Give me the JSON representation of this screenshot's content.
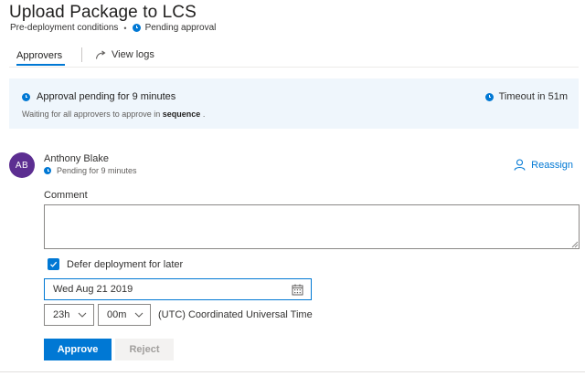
{
  "header": {
    "title": "Upload Package to LCS",
    "condition": "Pre-deployment conditions",
    "separator": "•",
    "status": "Pending approval"
  },
  "tabs": {
    "approvers": "Approvers",
    "view_logs": "View logs"
  },
  "banner": {
    "title": "Approval pending for 9 minutes",
    "subtitle_prefix": "Waiting for all approvers to approve in",
    "subtitle_emphasis": "sequence",
    "subtitle_suffix": ".",
    "timeout": "Timeout in 51m"
  },
  "approver": {
    "initials": "AB",
    "name": "Anthony Blake",
    "status": "Pending for 9 minutes",
    "reassign_label": "Reassign",
    "avatar_color": "#5c2e91"
  },
  "form": {
    "comment_label": "Comment",
    "comment_value": "",
    "defer_label": "Defer deployment for later",
    "defer_checked": true,
    "date_value": "Wed Aug 21 2019",
    "hour_value": "23h",
    "minute_value": "00m",
    "timezone": "(UTC) Coordinated Universal Time"
  },
  "actions": {
    "approve_label": "Approve",
    "reject_label": "Reject"
  },
  "colors": {
    "accent": "#0078d4",
    "banner_bg": "#eff6fc"
  }
}
